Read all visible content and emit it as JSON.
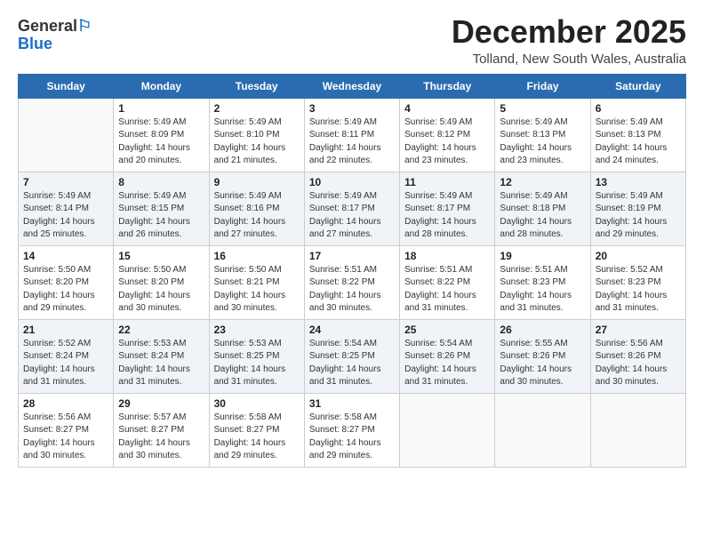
{
  "header": {
    "logo_general": "General",
    "logo_blue": "Blue",
    "month_title": "December 2025",
    "location": "Tolland, New South Wales, Australia"
  },
  "days_of_week": [
    "Sunday",
    "Monday",
    "Tuesday",
    "Wednesday",
    "Thursday",
    "Friday",
    "Saturday"
  ],
  "weeks": [
    [
      {
        "day": "",
        "info": ""
      },
      {
        "day": "1",
        "info": "Sunrise: 5:49 AM\nSunset: 8:09 PM\nDaylight: 14 hours\nand 20 minutes."
      },
      {
        "day": "2",
        "info": "Sunrise: 5:49 AM\nSunset: 8:10 PM\nDaylight: 14 hours\nand 21 minutes."
      },
      {
        "day": "3",
        "info": "Sunrise: 5:49 AM\nSunset: 8:11 PM\nDaylight: 14 hours\nand 22 minutes."
      },
      {
        "day": "4",
        "info": "Sunrise: 5:49 AM\nSunset: 8:12 PM\nDaylight: 14 hours\nand 23 minutes."
      },
      {
        "day": "5",
        "info": "Sunrise: 5:49 AM\nSunset: 8:13 PM\nDaylight: 14 hours\nand 23 minutes."
      },
      {
        "day": "6",
        "info": "Sunrise: 5:49 AM\nSunset: 8:13 PM\nDaylight: 14 hours\nand 24 minutes."
      }
    ],
    [
      {
        "day": "7",
        "info": "Sunrise: 5:49 AM\nSunset: 8:14 PM\nDaylight: 14 hours\nand 25 minutes."
      },
      {
        "day": "8",
        "info": "Sunrise: 5:49 AM\nSunset: 8:15 PM\nDaylight: 14 hours\nand 26 minutes."
      },
      {
        "day": "9",
        "info": "Sunrise: 5:49 AM\nSunset: 8:16 PM\nDaylight: 14 hours\nand 27 minutes."
      },
      {
        "day": "10",
        "info": "Sunrise: 5:49 AM\nSunset: 8:17 PM\nDaylight: 14 hours\nand 27 minutes."
      },
      {
        "day": "11",
        "info": "Sunrise: 5:49 AM\nSunset: 8:17 PM\nDaylight: 14 hours\nand 28 minutes."
      },
      {
        "day": "12",
        "info": "Sunrise: 5:49 AM\nSunset: 8:18 PM\nDaylight: 14 hours\nand 28 minutes."
      },
      {
        "day": "13",
        "info": "Sunrise: 5:49 AM\nSunset: 8:19 PM\nDaylight: 14 hours\nand 29 minutes."
      }
    ],
    [
      {
        "day": "14",
        "info": "Sunrise: 5:50 AM\nSunset: 8:20 PM\nDaylight: 14 hours\nand 29 minutes."
      },
      {
        "day": "15",
        "info": "Sunrise: 5:50 AM\nSunset: 8:20 PM\nDaylight: 14 hours\nand 30 minutes."
      },
      {
        "day": "16",
        "info": "Sunrise: 5:50 AM\nSunset: 8:21 PM\nDaylight: 14 hours\nand 30 minutes."
      },
      {
        "day": "17",
        "info": "Sunrise: 5:51 AM\nSunset: 8:22 PM\nDaylight: 14 hours\nand 30 minutes."
      },
      {
        "day": "18",
        "info": "Sunrise: 5:51 AM\nSunset: 8:22 PM\nDaylight: 14 hours\nand 31 minutes."
      },
      {
        "day": "19",
        "info": "Sunrise: 5:51 AM\nSunset: 8:23 PM\nDaylight: 14 hours\nand 31 minutes."
      },
      {
        "day": "20",
        "info": "Sunrise: 5:52 AM\nSunset: 8:23 PM\nDaylight: 14 hours\nand 31 minutes."
      }
    ],
    [
      {
        "day": "21",
        "info": "Sunrise: 5:52 AM\nSunset: 8:24 PM\nDaylight: 14 hours\nand 31 minutes."
      },
      {
        "day": "22",
        "info": "Sunrise: 5:53 AM\nSunset: 8:24 PM\nDaylight: 14 hours\nand 31 minutes."
      },
      {
        "day": "23",
        "info": "Sunrise: 5:53 AM\nSunset: 8:25 PM\nDaylight: 14 hours\nand 31 minutes."
      },
      {
        "day": "24",
        "info": "Sunrise: 5:54 AM\nSunset: 8:25 PM\nDaylight: 14 hours\nand 31 minutes."
      },
      {
        "day": "25",
        "info": "Sunrise: 5:54 AM\nSunset: 8:26 PM\nDaylight: 14 hours\nand 31 minutes."
      },
      {
        "day": "26",
        "info": "Sunrise: 5:55 AM\nSunset: 8:26 PM\nDaylight: 14 hours\nand 30 minutes."
      },
      {
        "day": "27",
        "info": "Sunrise: 5:56 AM\nSunset: 8:26 PM\nDaylight: 14 hours\nand 30 minutes."
      }
    ],
    [
      {
        "day": "28",
        "info": "Sunrise: 5:56 AM\nSunset: 8:27 PM\nDaylight: 14 hours\nand 30 minutes."
      },
      {
        "day": "29",
        "info": "Sunrise: 5:57 AM\nSunset: 8:27 PM\nDaylight: 14 hours\nand 30 minutes."
      },
      {
        "day": "30",
        "info": "Sunrise: 5:58 AM\nSunset: 8:27 PM\nDaylight: 14 hours\nand 29 minutes."
      },
      {
        "day": "31",
        "info": "Sunrise: 5:58 AM\nSunset: 8:27 PM\nDaylight: 14 hours\nand 29 minutes."
      },
      {
        "day": "",
        "info": ""
      },
      {
        "day": "",
        "info": ""
      },
      {
        "day": "",
        "info": ""
      }
    ]
  ]
}
